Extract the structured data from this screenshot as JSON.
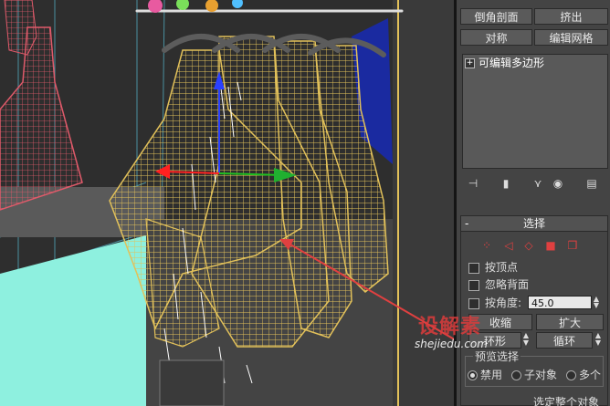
{
  "panel": {
    "buttons": {
      "chamfer_cut": "倒角剖面",
      "extrude": "挤出",
      "symmetry": "对称",
      "edit_mesh": "编辑网格"
    },
    "modifier_stack": {
      "expand_symbol": "+",
      "items": [
        "可编辑多边形"
      ]
    },
    "selection": {
      "title": "选择",
      "collapse_symbol": "-",
      "by_vertex": "按顶点",
      "ignore_backfacing": "忽略背面",
      "by_angle": "按角度:",
      "angle_value": "45.0",
      "shrink": "收缩",
      "grow": "扩大",
      "ring": "环形",
      "loop": "循环",
      "preview_selection": "预览选择",
      "preview_options": [
        "禁用",
        "子对象",
        "多个"
      ],
      "preview_selected_index": 0,
      "select_whole_object": "选定整个对象"
    }
  },
  "watermark": {
    "logo": "设解素",
    "url": "shejiedu.com"
  },
  "colors": {
    "viewport_bg": "#2e2e2e",
    "panel_bg": "#444444",
    "wireframe_yellow": "#e2c15a",
    "wireframe_pink": "#e05a6a",
    "accent_red": "#e04040",
    "cyan_plane": "#8ef0df"
  }
}
